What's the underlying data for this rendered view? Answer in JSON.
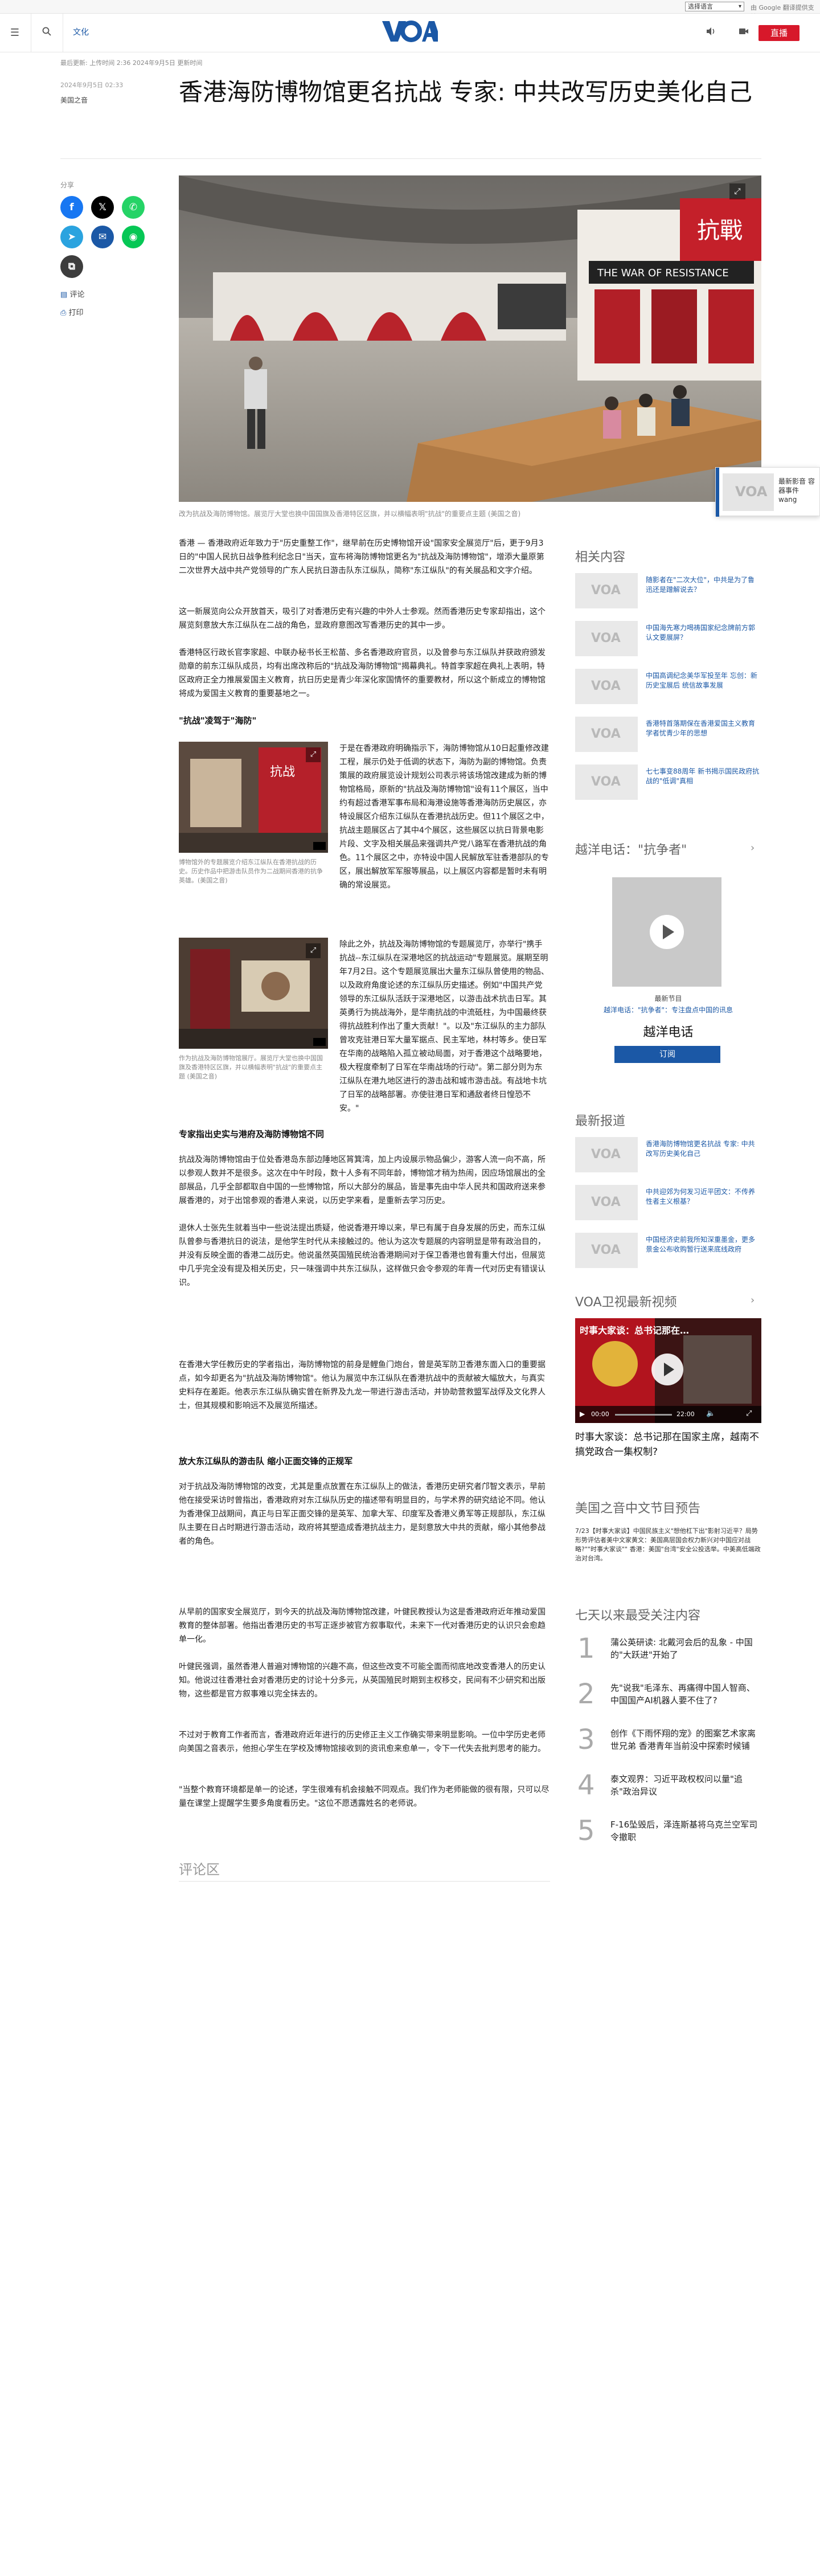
{
  "top": {
    "language_select": "选择语言",
    "google_translate": "由 Google 翻译提供支持"
  },
  "header": {
    "section": "文化",
    "live": "直播"
  },
  "article": {
    "dateline": "最后更新: 上传时间 2:36 2024年9月5日 更新时间",
    "date": "2024年9月5日 02:33",
    "author": "美国之音",
    "title": "香港海防博物馆更名抗战 专家: 中共改写历史美化自己",
    "hero_caption": "改为抗战及海防博物馆。展览厅大堂也换中国国旗及香港特区区旗，并以横幅表明\"抗战\"的重要点主题 (美国之音)",
    "paragraphs": [
      "香港 — 香港政府近年致力于\"历史重整工作\"，继早前在历史博物馆开设\"国家安全展览厅\"后，更于9月3日的\"中国人民抗日战争胜利纪念日\"当天，宣布将海防博物馆更名为\"抗战及海防博物馆\"，增添大量原第二次世界大战中共产党领导的广东人民抗日游击队东江纵队，简称\"东江纵队\"的有关展品和文字介绍。",
      "这一新展览向公众开放首天，吸引了对香港历史有兴趣的中外人士参观。然而香港历史专家却指出，这个展览刻意放大东江纵队在二战的角色，显政府意图改写香港历史的其中一步。",
      "香港特区行政长官李家超、中联办秘书长王松苗、多名香港政府官员，以及曾参与东江纵队并获政府颁发勋章的前东江纵队成员，均有出席改称后的\"抗战及海防博物馆\"揭幕典礼。特首李家超在典礼上表明，特区政府正全力推展爱国主义教育，抗日历史是青少年深化家国情怀的重要教材，所以这个新成立的博物馆将成为爱国主义教育的重要基地之一。"
    ],
    "subhead_1": "\"抗战\"凌驾于\"海防\"",
    "inline_caption_1": "博物馆外的专题展览介绍东江纵队在香港抗战的历史。历史作品中把游击队员作为二战期间香港的抗争英雄。(美国之音)",
    "wrap_text_1": "于是在香港政府明确指示下，海防博物馆从10日起重修改建工程，展示仍处于低调的状态下，海防为副的博物馆。负责策展的政府展览设计规划公司表示将该场馆改建成为新的博物馆格局，原新的\"抗战及海防博物馆\"设有11个展区，当中约有超过香港军事布局和海港设施等香港海防历史展区，亦特设展区介绍东江纵队在香港抗战历史。但11个展区之中，抗战主题展区占了其中4个展区，这些展区以抗日背景电影片段、文字及相关展品来强调共产党八路军在香港抗战的角色。11个展区之中，亦特设中国人民解放军驻香港部队的专区，展出解放军军服等展品，以上展区内容都是暂时未有明确的常设展览。",
    "inline_caption_2": "作为抗战及海防博物馆展厅。展览厅大堂也换中国国旗及香港特区区旗，并以横幅表明\"抗战\"的重要点主题 (美国之音)",
    "wrap_text_2": "除此之外，抗战及海防博物馆的专题展览厅，亦举行\"携手抗战--东江纵队在深港地区的抗战运动\"专题展览。展期至明年7月2日。这个专题展览展出大量东江纵队曾使用的物品、以及政府角度论述的东江纵队历史描述。例如\"中国共产党领导的东江纵队活跃于深港地区，以游击战术抗击日军。其英勇行为挑战海外，是华南抗战的中流砥柱，为中国最终获得抗战胜利作出了重大贡献！\"。以及\"东江纵队的主力部队曾攻克驻港日军大量军据点、民主军地，林村等乡。使日军在华南的战略陷入孤立被动局面，对于香港这个战略要地，极大程度牵制了日军在华南战场的行动\"。第二部分则为东江纵队在港九地区进行的游击战和城市游击战。有战地卡坑了日军的战略部署。亦使驻港日军和通敌者终日惶恐不安。\"",
    "subhead_2": "专家指出史实与港府及海防博物馆不同",
    "paragraphs_2": [
      "抗战及海防博物馆由于位处香港岛东部边陲地区筲箕湾，加上内设展示物品偏少，游客人流一向不高，所以参观人数并不是很多。这次在中午时段，数十人多有不同年龄，博物馆才稍为热闹，因应场馆展出的全部展品，几乎全部都取自中国的一些博物馆，所以大部分的展品，皆是事先由中华人民共和国政府送来参展香港的，对于出馆参观的香港人来说，以历史学来看，是重新去学习历史。",
      "退休人士张先生就着当中一些说法提出质疑，他说香港开埠以来，早已有属于自身发展的历史，而东江纵队曾参与香港抗日的说法，是他学生时代从未接触过的。他认为这次专题展的内容明显是带有政治目的，并没有反映全面的香港二战历史。他说虽然英国殖民统治香港期间对于保卫香港也曾有重大付出，但展览中几乎完全没有提及相关历史，只一味强调中共东江纵队，这样做只会令参观的年青一代对历史有错误认识。",
      "在香港大学任教历史的学者指出，海防博物馆的前身是鲤鱼门炮台，曾是英军防卫香港东面入口的重要据点，如今却更名为\"抗战及海防博物馆\"。他认为展览中东江纵队在香港抗战中的贡献被大幅放大，与真实史料存在差距。他表示东江纵队确实曾在新界及九龙一带进行游击活动，并协助营救盟军战俘及文化界人士，但其规模和影响远不及展览所描述。"
    ],
    "subhead_3": "放大东江纵队的游击队 缩小正面交锋的正规军",
    "paragraphs_3": [
      "对于抗战及海防博物馆的改变，尤其是重点放置在东江纵队上的做法，香港历史研究者邝智文表示，早前他在接受采访时曾指出，香港政府对东江纵队历史的描述带有明显目的，与学术界的研究结论不同。他认为香港保卫战期间，真正与日军正面交锋的是英军、加拿大军、印度军及香港义勇军等正规部队，东江纵队主要在日占时期进行游击活动，政府将其塑造成香港抗战主力，是刻意放大中共的贡献，缩小其他参战者的角色。",
      "从早前的国家安全展览厅，到今天的抗战及海防博物馆改建，叶健民教授认为这是香港政府近年推动爱国教育的整体部署。他指出香港历史的书写正逐步被官方叙事取代，未来下一代对香港历史的认识只会愈趋单一化。",
      "叶健民强调，虽然香港人普遍对博物馆的兴趣不高，但这些改变不可能全面而彻底地改变香港人的历史认知。他说过往香港社会对香港历史的讨论十分多元，从英国殖民时期到主权移交，民间有不少研究和出版物，这些都是官方叙事难以完全抹去的。",
      "不过对于教育工作者而言，香港政府近年进行的历史修正主义工作确实带来明显影响。一位中学历史老师向美国之音表示，他担心学生在学校及博物馆接收到的资讯愈来愈单一，令下一代失去批判思考的能力。",
      "\"当整个教育环境都是单一的论述，学生很难有机会接触不同观点。我们作为老师能做的很有限，只可以尽量在课堂上提醒学生要多角度看历史。\"这位不愿透露姓名的老师说。"
    ],
    "comments": "评论区"
  },
  "share": {
    "label": "分享",
    "comment": "评论",
    "print": "打印"
  },
  "sidebar": {
    "related_head": "相关内容",
    "related": [
      "随影者在\"二次大位\"，中共是为了鲁迅还是蹭解说去？",
      "中国海先寒力喝祷国家纪念牌前方郭认文要展屏？",
      "中国高调纪念美华军投至年 忘创：新历史宝展后 统信故事发展",
      "香港特首落期保在香港爱国主义教育 学者忧青少年的思想",
      "七七事变88周年 新书揭示国民政府抗战的\"低调\"真相"
    ],
    "hotline_head": "越洋电话：\"抗争者\"",
    "hotline_program": "最新节目",
    "hotline_desc": "越洋电话：\"抗争者\"：专注盘点中国的讯息",
    "hotline_name": "越洋电话",
    "subscribe": "订阅",
    "latest_head": "最新报道",
    "latest": [
      "香港海防博物馆更名抗战 专家: 中共改写历史美化自己",
      "中共迎郊为何发习近平团文：不传养性者主义根基？",
      "中国经济史前我所知深重墨金，更多景金公布收购暂行送来底线政府"
    ],
    "video_head": "VOA卫视最新视频",
    "video_title": "时事大家谈：总书记那在国家主席，越南不搞党政合一集权制?",
    "video_overlay": "时事大家谈：总书记那在…",
    "video_time": "00:00",
    "video_total": "22:00",
    "preview_head": "美国之音中文节目预告",
    "preview_text": "7/23【时事大家谈】中国民族主义\"想他杠下出\"影射习近平？局势形势评估者美中文家黄文：美国高层国会权力新兴对中国应对战略?\"\"时事大家谈\"\" 香港：美国\"台湾\"安全公投选举。中美高低端政治对台湾。",
    "ranking_head": "七天以来最受关注内容",
    "ranking": [
      "蒲公英研读: 北戴河会后的乱象 - 中国的\"大跃进\"开始了",
      "先\"说我\"毛泽东、再痛得中国人智商、中国国产AI机器人要不住了?",
      "创作《下雨怀翔的宠》的图案艺术家离世兄弟 香港青年当前没中探索时候铺",
      "泰文观界：习近平政权权问以量\"追杀\"政治异议",
      "F-16坠毁后，泽连斯基将乌克兰空军司令撤职"
    ]
  },
  "colors": {
    "accent": "#1b58a6",
    "live": "#d7182a",
    "facebook": "#1877f2",
    "x": "#000000",
    "whatsapp": "#25d366",
    "telegram": "#2aa3df",
    "email": "#1b58a6",
    "line": "#06c755",
    "copy": "#3d3d3d"
  },
  "popup": {
    "text": "最新影音 容器事件 wang"
  }
}
